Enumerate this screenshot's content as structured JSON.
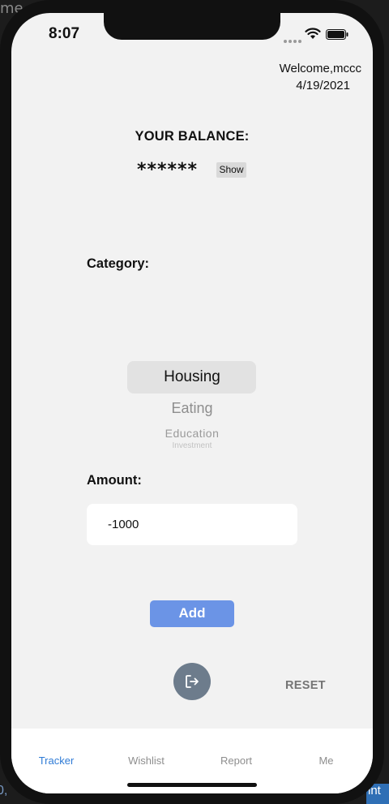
{
  "status_bar": {
    "time": "8:07"
  },
  "header": {
    "welcome": "Welcome,mccc",
    "date": "4/19/2021"
  },
  "balance": {
    "title": "YOUR BALANCE:",
    "masked_value": "******",
    "show_label": "Show"
  },
  "category": {
    "label": "Category:",
    "options": [
      "Housing",
      "Eating",
      "Education",
      "Investment"
    ],
    "selected": "Housing"
  },
  "amount": {
    "label": "Amount:",
    "value": "-1000"
  },
  "actions": {
    "add_label": "Add",
    "reset_label": "RESET",
    "logout_icon": "logout-icon"
  },
  "tabs": [
    {
      "label": "Tracker",
      "active": true
    },
    {
      "label": "Wishlist",
      "active": false
    },
    {
      "label": "Report",
      "active": false
    },
    {
      "label": "Me",
      "active": false
    }
  ],
  "colors": {
    "accent": "#6b94e6",
    "tab_active": "#2f7bd6",
    "background": "#f2f2f2"
  }
}
